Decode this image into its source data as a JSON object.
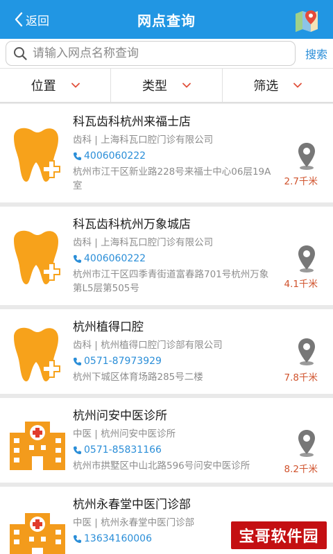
{
  "header": {
    "back_label": "返回",
    "title": "网点查询",
    "map_icon": "map-icon"
  },
  "search": {
    "placeholder": "请输入网点名称查询",
    "button_label": "搜索"
  },
  "filters": [
    {
      "label": "位置"
    },
    {
      "label": "类型"
    },
    {
      "label": "筛选"
    }
  ],
  "clinics": [
    {
      "name": "科瓦齿科杭州来福士店",
      "category": "齿科 | 上海科瓦口腔门诊有限公司",
      "phone": "4006060222",
      "address": "杭州市江干区新业路228号来福士中心06层19A室",
      "distance": "2.7千米",
      "icon": "tooth-icon"
    },
    {
      "name": "科瓦齿科杭州万象城店",
      "category": "齿科 | 上海科瓦口腔门诊有限公司",
      "phone": "4006060222",
      "address": "杭州市江干区四季青街道富春路701号杭州万象第L5层第505号",
      "distance": "4.1千米",
      "icon": "tooth-icon"
    },
    {
      "name": "杭州植得口腔",
      "category": "齿科 | 杭州植得口腔门诊部有限公司",
      "phone": "0571-87973929",
      "address": "杭州下城区体育场路285号二楼",
      "distance": "7.8千米",
      "icon": "tooth-icon"
    },
    {
      "name": "杭州问安中医诊所",
      "category": "中医 | 杭州问安中医诊所",
      "phone": "0571-85831166",
      "address": "杭州市拱墅区中山北路596号问安中医诊所",
      "distance": "8.2千米",
      "icon": "hospital-icon"
    },
    {
      "name": "杭州永春堂中医门诊部",
      "category": "中医 | 杭州永春堂中医门诊部",
      "phone": "13634160006",
      "address": "",
      "distance": "",
      "icon": "hospital-icon"
    }
  ],
  "watermark": "宝哥软件园",
  "colors": {
    "header": "#2196e3",
    "accent_blue": "#2a8ed8",
    "tooth_orange": "#f7a21b",
    "hospital_orange": "#f39b1c",
    "distance_red": "#d0522c",
    "watermark_red": "#c40f12"
  }
}
